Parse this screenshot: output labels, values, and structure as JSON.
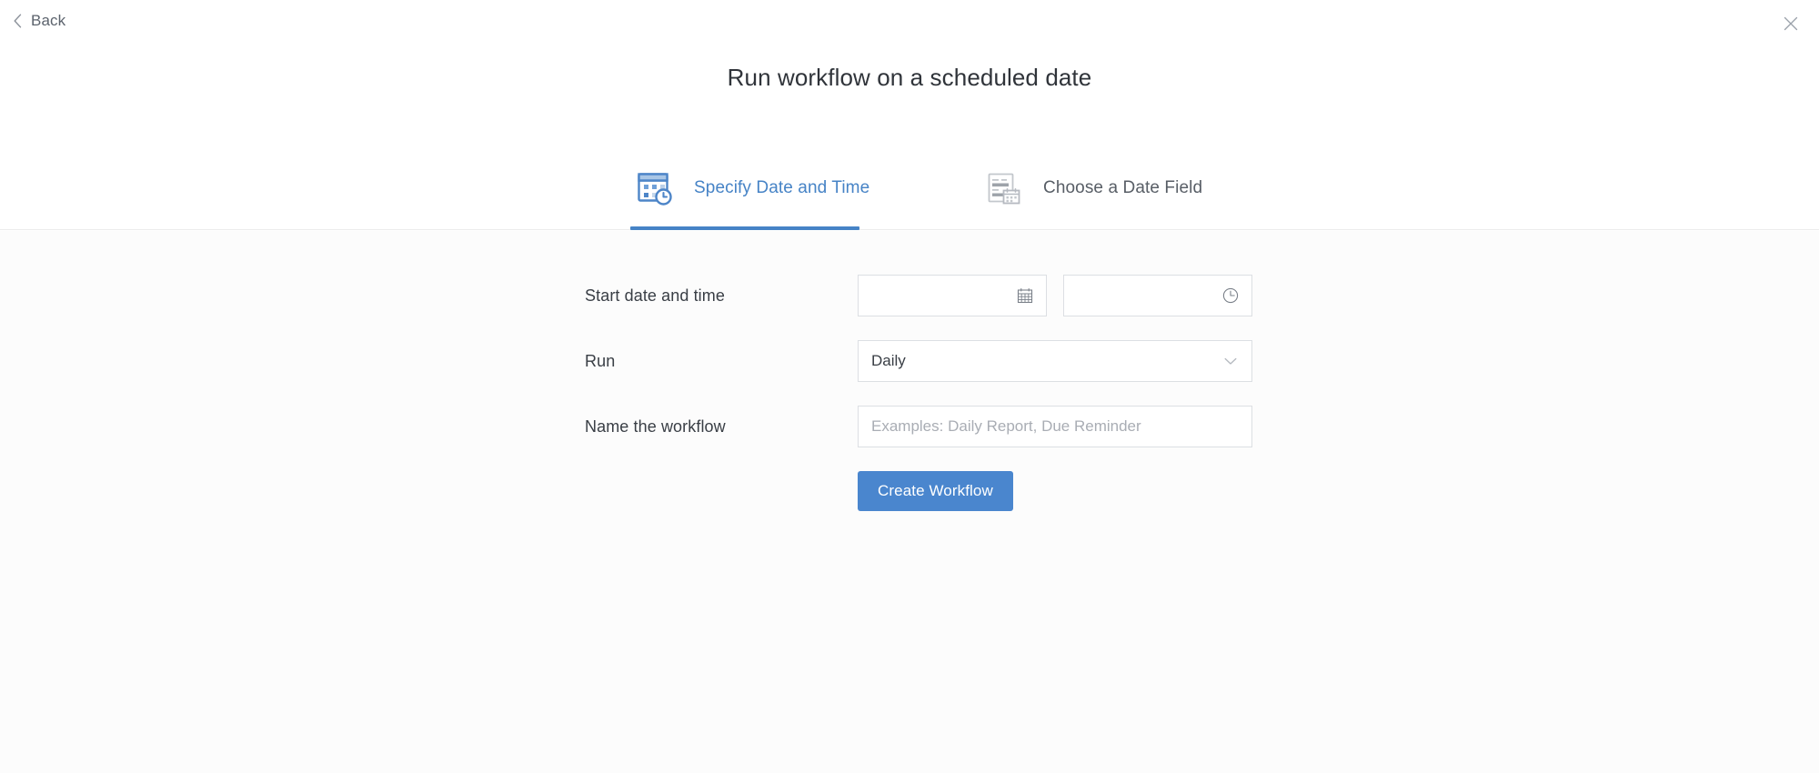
{
  "header": {
    "back_label": "Back",
    "back_icon": "chevron-left-icon",
    "close_icon": "close-icon",
    "title": "Run workflow on a scheduled date"
  },
  "tabs": [
    {
      "label": "Specify Date and Time",
      "icon": "calendar-clock-icon",
      "active": true,
      "accent_color": "#4683c6"
    },
    {
      "label": "Choose a Date Field",
      "icon": "form-calendar-icon",
      "active": false,
      "color": "#9a9fa6"
    }
  ],
  "form": {
    "rows": [
      {
        "label": "Start date and time",
        "date_input": {
          "value": "",
          "placeholder": "",
          "icon": "calendar-icon"
        },
        "time_input": {
          "value": "",
          "placeholder": "",
          "icon": "clock-icon"
        }
      },
      {
        "label": "Run",
        "select": {
          "value": "Daily",
          "icon": "chevron-down-icon"
        }
      },
      {
        "label": "Name the workflow",
        "text_input": {
          "value": "",
          "placeholder": "Examples: Daily Report, Due Reminder"
        }
      }
    ],
    "submit_label": "Create Workflow"
  },
  "colors": {
    "accent": "#4683c6",
    "button": "#4a86ce",
    "page_bg": "#ffffff",
    "body_bg": "#fcfcfc",
    "border": "#dcdfe3",
    "text": "#393e45",
    "muted_text": "#a9adb4"
  }
}
